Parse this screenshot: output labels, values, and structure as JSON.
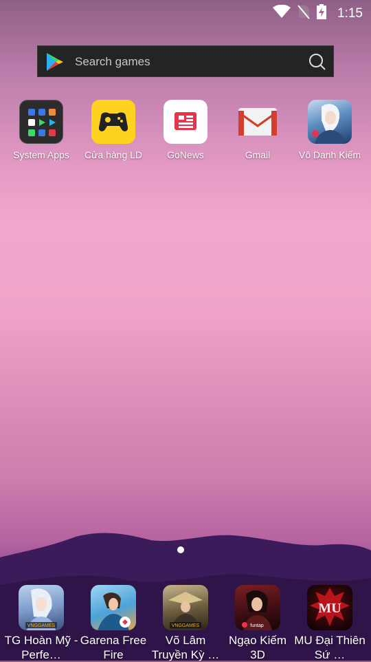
{
  "status": {
    "time": "1:15"
  },
  "search": {
    "placeholder": "Search games"
  },
  "apps": [
    {
      "label": "System Apps"
    },
    {
      "label": "Cửa hàng LD"
    },
    {
      "label": "GoNews"
    },
    {
      "label": "Gmail"
    },
    {
      "label": "Vô Danh Kiếm"
    }
  ],
  "dock": [
    {
      "label": "TG Hoàn Mỹ - Perfe…"
    },
    {
      "label": "Garena Free Fire"
    },
    {
      "label": "Võ Lâm Truyền Kỳ …"
    },
    {
      "label": "Ngạo Kiếm 3D"
    },
    {
      "label": "MU Đại Thiên Sứ …"
    }
  ],
  "icon_text": {
    "vng": "VNGGAMES",
    "funtap": "funtap",
    "mu": "MU"
  },
  "page_indicator": {
    "current": 1,
    "total": 1
  }
}
